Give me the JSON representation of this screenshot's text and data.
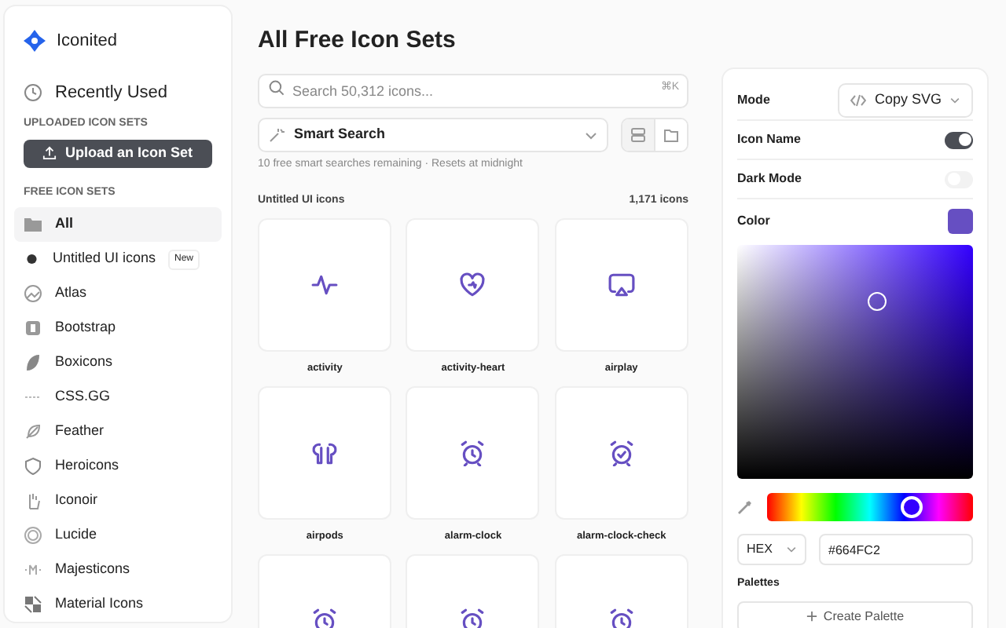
{
  "app": {
    "name": "Iconited"
  },
  "sidebar": {
    "recent": "Recently Used",
    "uploaded_heading": "UPLOADED ICON SETS",
    "upload_button": "Upload an Icon Set",
    "free_heading": "FREE ICON SETS",
    "items": [
      {
        "label": "All",
        "kind": "folder",
        "selected": true
      },
      {
        "label": "Untitled UI icons",
        "kind": "blob",
        "selected": false,
        "badge": "New"
      },
      {
        "label": "Atlas",
        "kind": "globe",
        "selected": false
      },
      {
        "label": "Bootstrap",
        "kind": "bootstrap",
        "selected": false
      },
      {
        "label": "Boxicons",
        "kind": "leaf",
        "selected": false
      },
      {
        "label": "CSS.GG",
        "kind": "dash",
        "selected": false
      },
      {
        "label": "Feather",
        "kind": "feather",
        "selected": false
      },
      {
        "label": "Heroicons",
        "kind": "shield",
        "selected": false
      },
      {
        "label": "Iconoir",
        "kind": "hand",
        "selected": false
      },
      {
        "label": "Lucide",
        "kind": "rings",
        "selected": false
      },
      {
        "label": "Majesticons",
        "kind": "majestic",
        "selected": false
      },
      {
        "label": "Material Icons",
        "kind": "material",
        "selected": false
      }
    ]
  },
  "main": {
    "title": "All Free Icon Sets",
    "search": {
      "placeholder": "Search 50,312 icons...",
      "shortcut": "⌘K"
    },
    "smart_search": "Smart Search",
    "views": [
      {
        "kind": "list",
        "selected": true
      },
      {
        "kind": "folder",
        "selected": false
      }
    ],
    "note": "10 free smart searches remaining · Resets at midnight",
    "set_name": "Untitled UI icons",
    "count": "1,171 icons",
    "icons": [
      {
        "name": "activity",
        "kind": "activity"
      },
      {
        "name": "activity-heart",
        "kind": "heart"
      },
      {
        "name": "airplay",
        "kind": "airplay"
      },
      {
        "name": "airpods",
        "kind": "airpods"
      },
      {
        "name": "alarm-clock",
        "kind": "alarm"
      },
      {
        "name": "alarm-clock-check",
        "kind": "alarm-check"
      },
      {
        "kind": "alarm"
      },
      {
        "kind": "alarm"
      },
      {
        "kind": "alarm"
      }
    ]
  },
  "settings": {
    "mode_label": "Mode",
    "mode_value": "Copy SVG",
    "toggles": [
      {
        "label": "Icon Name",
        "on": true
      },
      {
        "label": "Dark Mode",
        "on": false
      }
    ],
    "color_label": "Color",
    "hue_slider": {
      "level": 0.7
    },
    "format": "HEX",
    "hex": "#664FC2",
    "palettes_label": "Palettes",
    "create_palette": "Create Palette"
  }
}
